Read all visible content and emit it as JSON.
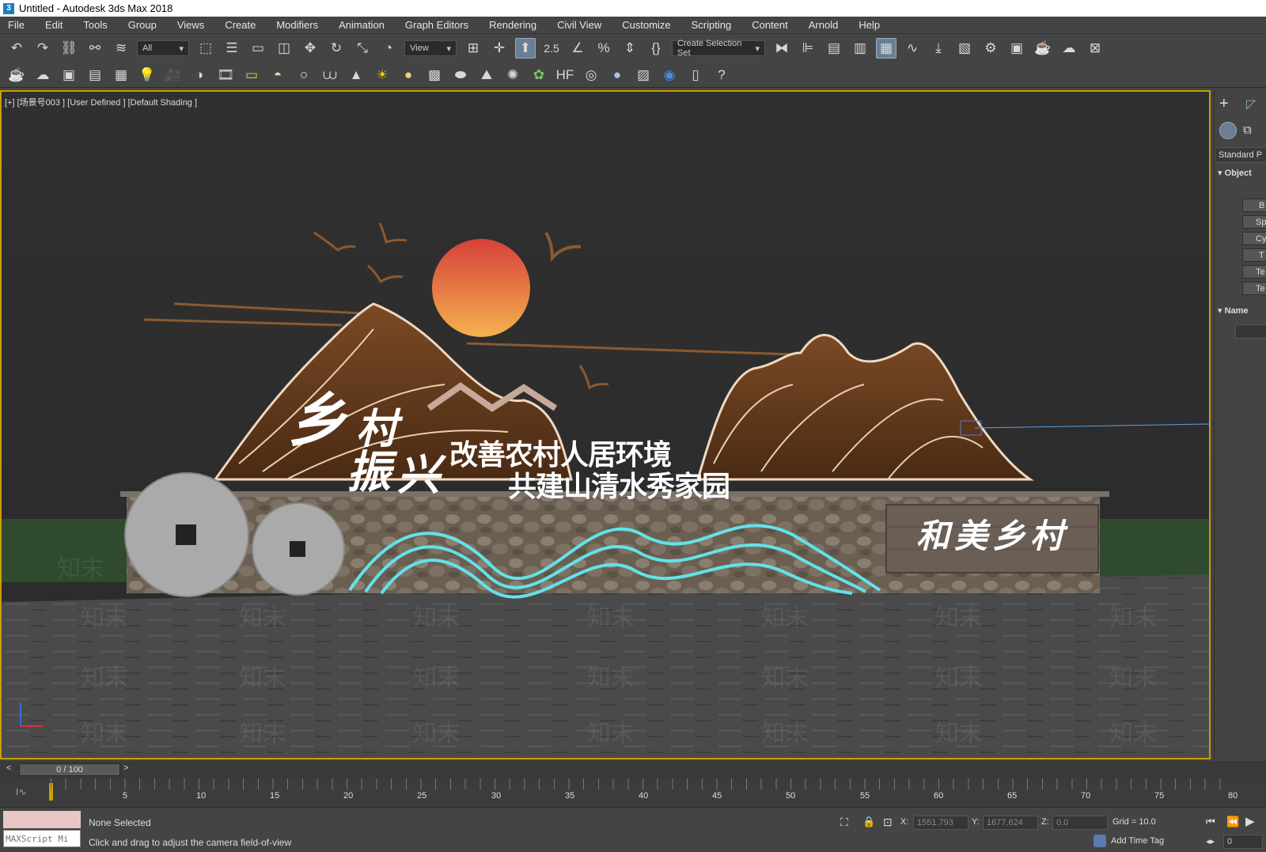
{
  "window": {
    "title": "Untitled - Autodesk 3ds Max 2018",
    "icon_label": "3"
  },
  "menu": [
    "File",
    "Edit",
    "Tools",
    "Group",
    "Views",
    "Create",
    "Modifiers",
    "Animation",
    "Graph Editors",
    "Rendering",
    "Civil View",
    "Customize",
    "Scripting",
    "Content",
    "Arnold",
    "Help"
  ],
  "toolbar": {
    "filter_value": "All",
    "refcoord_value": "View",
    "selection_set_placeholder": "Create Selection Set",
    "angle_snap_label": "2.5"
  },
  "viewport": {
    "label": "[+] [场景号003 ] [User Defined ] [Default Shading ]",
    "signage": {
      "title_chars": [
        "乡",
        "村",
        "振",
        "兴"
      ],
      "slogan_line1": "改善农村人居环境",
      "slogan_line2": "共建山清水秀家园",
      "board_text": "和美乡村"
    },
    "watermark": "知末"
  },
  "command_panel": {
    "dropdown": "Standard P",
    "rollout_object": "Object",
    "rollout_name": "Name",
    "buttons": [
      "B",
      "Sp",
      "Cy",
      "T",
      "Te",
      "Te"
    ]
  },
  "timeline": {
    "frame_display": "0 / 100",
    "ticks": [
      "5",
      "10",
      "15",
      "20",
      "25",
      "30",
      "35",
      "40",
      "45",
      "50",
      "55",
      "60",
      "65",
      "70",
      "75",
      "80"
    ]
  },
  "status": {
    "script_placeholder": "MAXScript Mi",
    "selection": "None Selected",
    "prompt": "Click and drag to adjust the camera field-of-view",
    "x_label": "X:",
    "x_value": "1551.793",
    "y_label": "Y:",
    "y_value": "1677.624",
    "z_label": "Z:",
    "z_value": "0.0",
    "grid": "Grid = 10.0",
    "add_time_tag": "Add Time Tag",
    "frame_field": "0"
  },
  "colors": {
    "viewport_border": "#c8a000",
    "active_button": "#6a7e94",
    "sun": "#e5603a"
  }
}
